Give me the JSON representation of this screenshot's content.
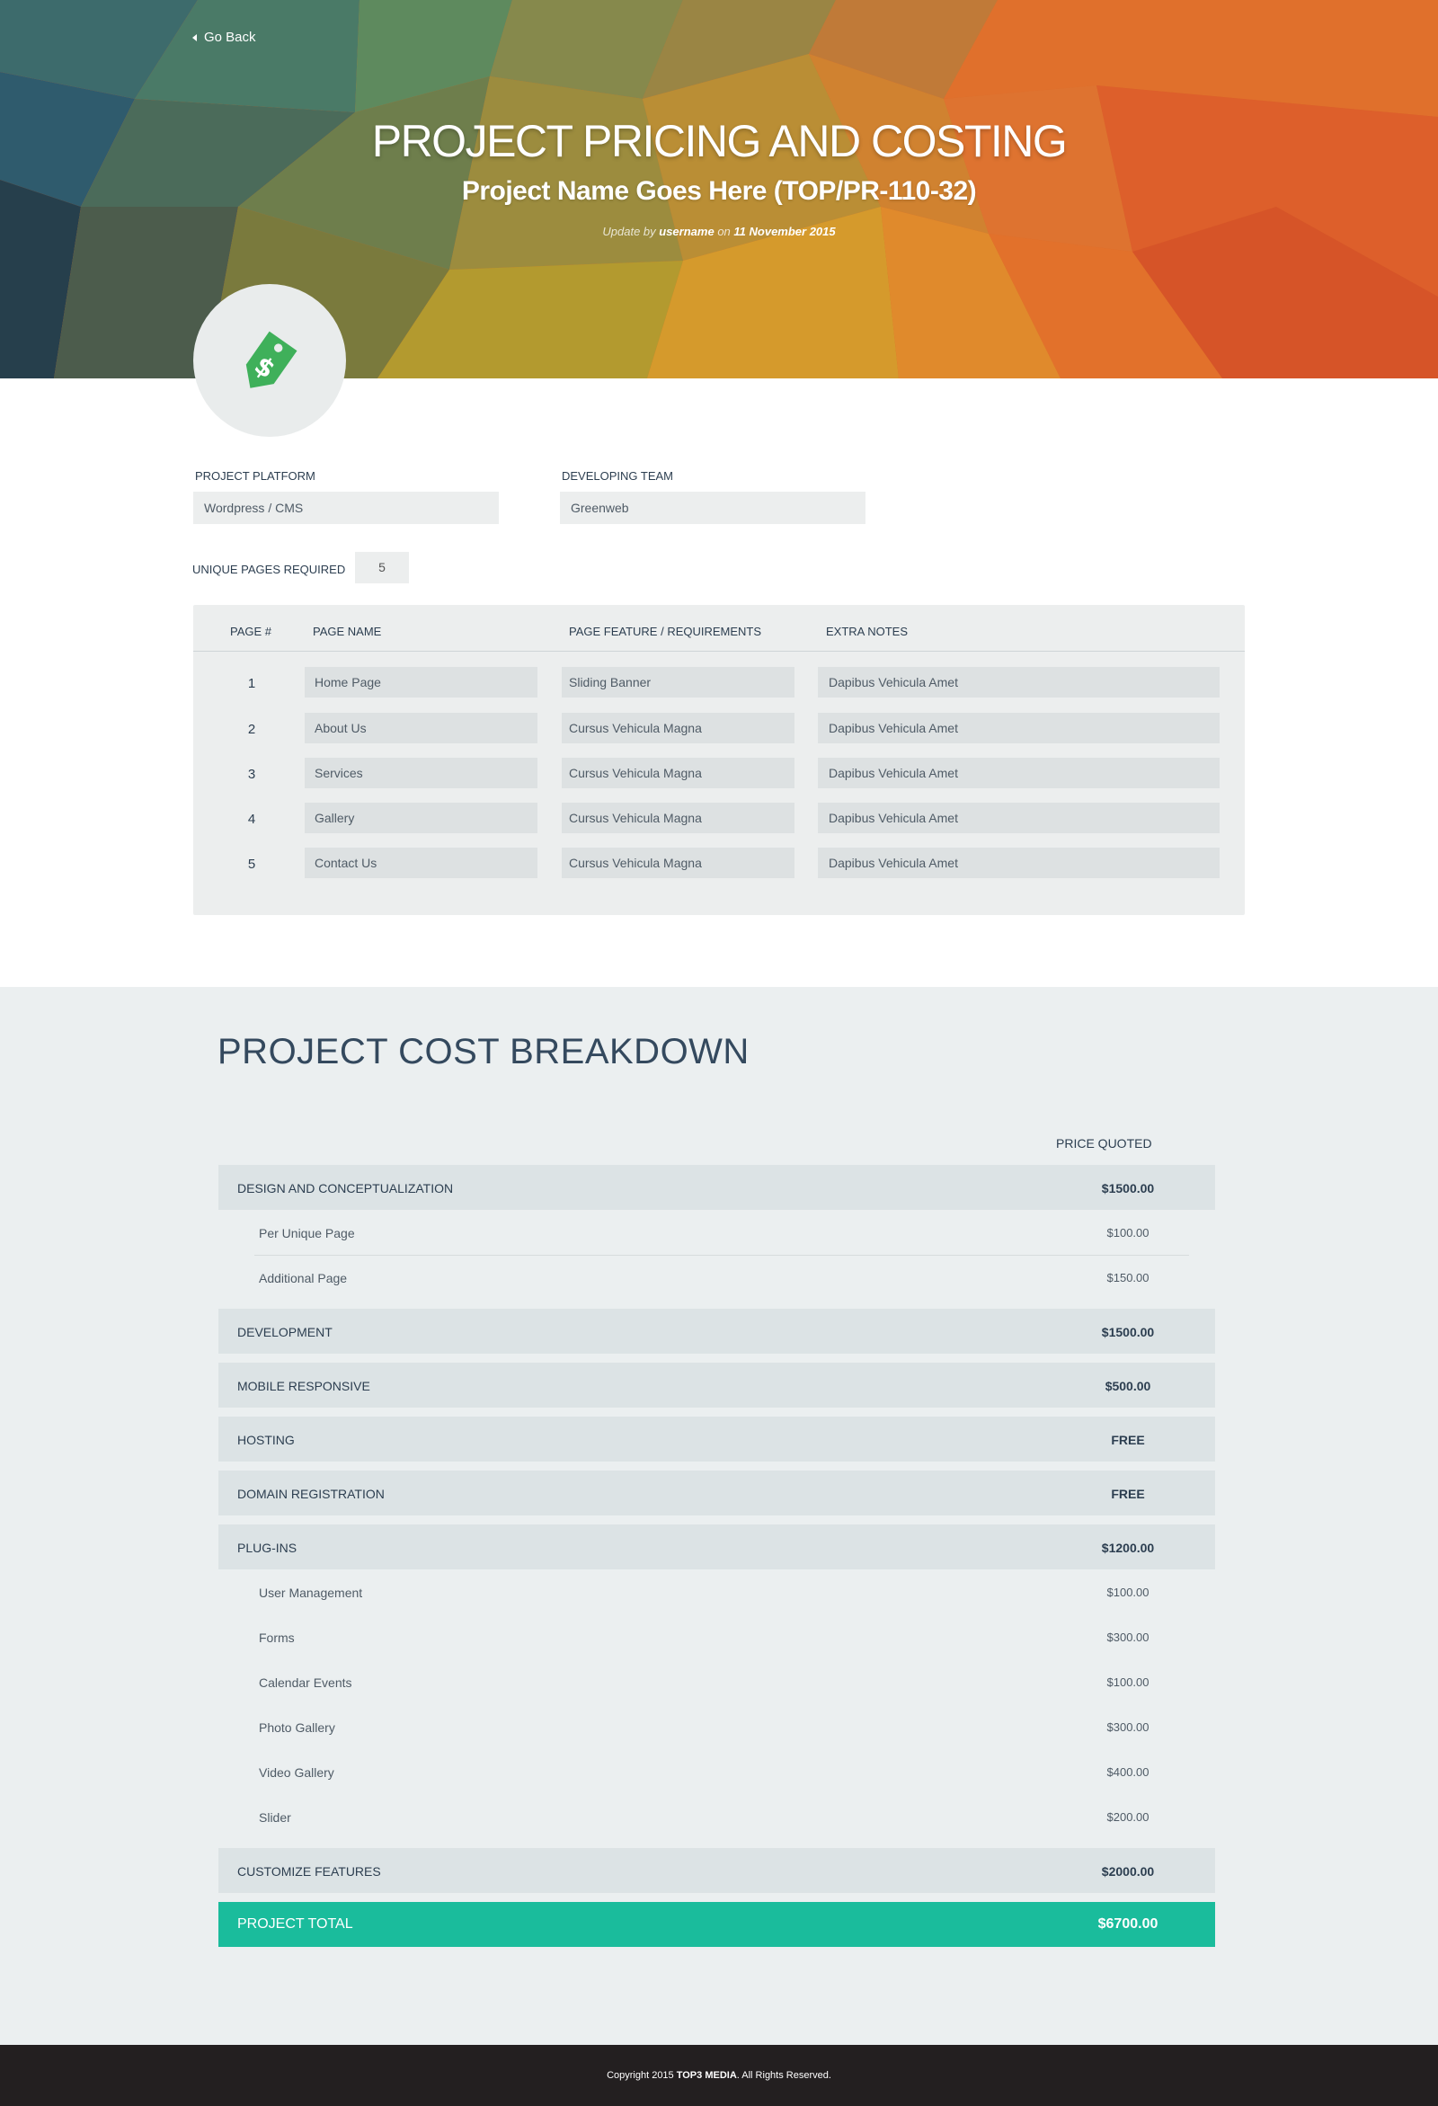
{
  "nav": {
    "go_back_label": "Go Back"
  },
  "hero": {
    "title": "PROJECT PRICING AND COSTING",
    "subtitle": "Project Name Goes Here (TOP/PR-110-32)",
    "update_prefix": "Update by",
    "update_user": "username",
    "update_on": "on",
    "update_date": "11 November 2015",
    "icon": "price-tag-dollar-icon",
    "accent_colors": [
      "#2f5f6e",
      "#c7a33a",
      "#e4762a",
      "#d9522a"
    ]
  },
  "form": {
    "platform_label": "PROJECT PLATFORM",
    "platform_value": "Wordpress / CMS",
    "team_label": "DEVELOPING TEAM",
    "team_value": "Greenweb",
    "unique_pages_label": "UNIQUE PAGES REQUIRED",
    "unique_pages_value": "5"
  },
  "pages_table": {
    "headers": [
      "PAGE #",
      "PAGE NAME",
      "PAGE FEATURE / REQUIREMENTS",
      "EXTRA NOTES"
    ],
    "rows": [
      {
        "num": "1",
        "name": "Home Page",
        "feature": "Sliding Banner",
        "notes": "Dapibus Vehicula Amet"
      },
      {
        "num": "2",
        "name": "About Us",
        "feature": "Cursus Vehicula Magna",
        "notes": "Dapibus Vehicula Amet"
      },
      {
        "num": "3",
        "name": "Services",
        "feature": "Cursus Vehicula Magna",
        "notes": "Dapibus Vehicula Amet"
      },
      {
        "num": "4",
        "name": "Gallery",
        "feature": "Cursus Vehicula Magna",
        "notes": "Dapibus Vehicula Amet"
      },
      {
        "num": "5",
        "name": "Contact Us",
        "feature": "Cursus Vehicula Magna",
        "notes": "Dapibus Vehicula Amet"
      }
    ]
  },
  "cost": {
    "title": "PROJECT COST BREAKDOWN",
    "price_quoted_header": "PRICE QUOTED",
    "design": {
      "label": "DESIGN AND CONCEPTUALIZATION",
      "price": "$1500.00",
      "items": [
        {
          "label": "Per Unique Page",
          "price": "$100.00"
        },
        {
          "label": "Additional Page",
          "price": "$150.00"
        }
      ]
    },
    "development": {
      "label": "DEVELOPMENT",
      "price": "$1500.00"
    },
    "mobile": {
      "label": "MOBILE RESPONSIVE",
      "price": "$500.00"
    },
    "hosting": {
      "label": "HOSTING",
      "price": "FREE"
    },
    "domain": {
      "label": "DOMAIN REGISTRATION",
      "price": "FREE"
    },
    "plugins": {
      "label": "PLUG-INS",
      "price": "$1200.00",
      "items": [
        {
          "label": "User Management",
          "price": "$100.00"
        },
        {
          "label": "Forms",
          "price": "$300.00"
        },
        {
          "label": "Calendar Events",
          "price": "$100.00"
        },
        {
          "label": "Photo Gallery",
          "price": "$300.00"
        },
        {
          "label": "Video Gallery",
          "price": "$400.00"
        },
        {
          "label": "Slider",
          "price": "$200.00"
        }
      ]
    },
    "customize": {
      "label": "CUSTOMIZE FEATURES",
      "price": "$2000.00"
    },
    "total": {
      "label": "PROJECT TOTAL",
      "price": "$6700.00",
      "color": "#1abc9c"
    }
  },
  "footer": {
    "copyright_prefix": "Copyright 2015",
    "company": "TOP3 MEDIA",
    "copyright_suffix": ". All Rights Reserved."
  }
}
